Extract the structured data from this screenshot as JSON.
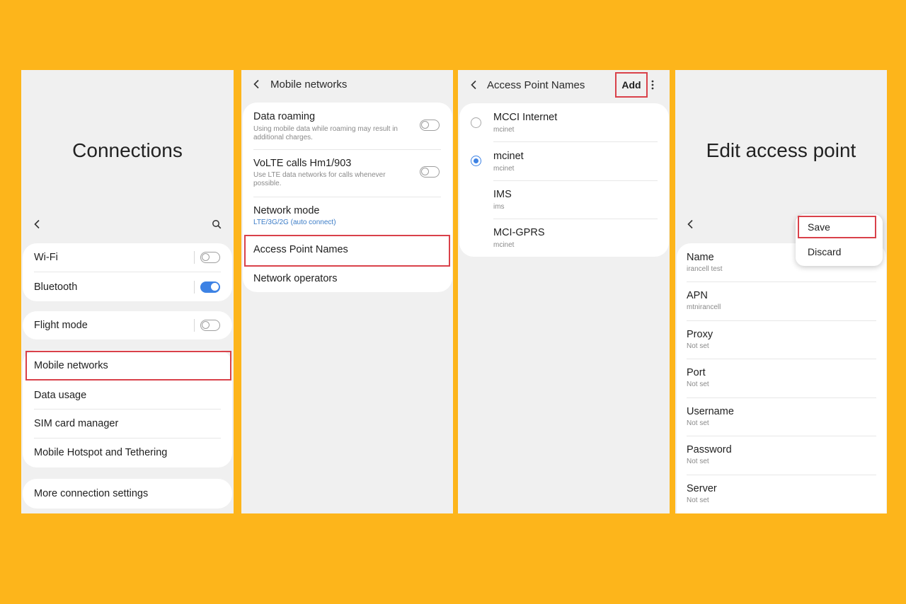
{
  "connections": {
    "title": "Connections",
    "items": [
      {
        "label": "Wi-Fi",
        "toggle": "off"
      },
      {
        "label": "Bluetooth",
        "toggle": "on"
      },
      {
        "label": "Flight mode",
        "toggle": "off"
      },
      {
        "label": "Mobile networks"
      },
      {
        "label": "Data usage"
      },
      {
        "label": "SIM card manager"
      },
      {
        "label": "Mobile Hotspot and Tethering"
      },
      {
        "label": "More connection settings"
      }
    ]
  },
  "mobile_networks": {
    "title": "Mobile networks",
    "items": [
      {
        "label": "Data roaming",
        "desc1": "Using mobile data while roaming may result in",
        "desc2": "additional charges.",
        "toggle": "off"
      },
      {
        "label": "VoLTE calls Hm1/903",
        "desc1": "Use LTE data networks for calls whenever",
        "desc2": "possible.",
        "toggle": "off"
      },
      {
        "label": "Network mode",
        "value": "LTE/3G/2G (auto connect)"
      },
      {
        "label": "Access Point Names"
      },
      {
        "label": "Network operators"
      }
    ]
  },
  "apn_list": {
    "title": "Access Point Names",
    "add_label": "Add",
    "items": [
      {
        "name": "MCCI Internet",
        "apn": "mcinet",
        "selected": false
      },
      {
        "name": "mcinet",
        "apn": "mcinet",
        "selected": true
      },
      {
        "name": "IMS",
        "apn": "ims",
        "selected": false
      },
      {
        "name": "MCI-GPRS",
        "apn": "mcinet",
        "selected": false
      }
    ]
  },
  "edit_apn": {
    "title": "Edit access point",
    "menu": {
      "save": "Save",
      "discard": "Discard"
    },
    "fields": [
      {
        "label": "Name",
        "value": "irancell test"
      },
      {
        "label": "APN",
        "value": "mtnirancell"
      },
      {
        "label": "Proxy",
        "value": "Not set"
      },
      {
        "label": "Port",
        "value": "Not set"
      },
      {
        "label": "Username",
        "value": "Not set"
      },
      {
        "label": "Password",
        "value": "Not set"
      },
      {
        "label": "Server",
        "value": "Not set"
      }
    ]
  },
  "colors": {
    "background": "#FDB51B",
    "highlight": "#d9414a",
    "accent": "#3d82e4"
  }
}
